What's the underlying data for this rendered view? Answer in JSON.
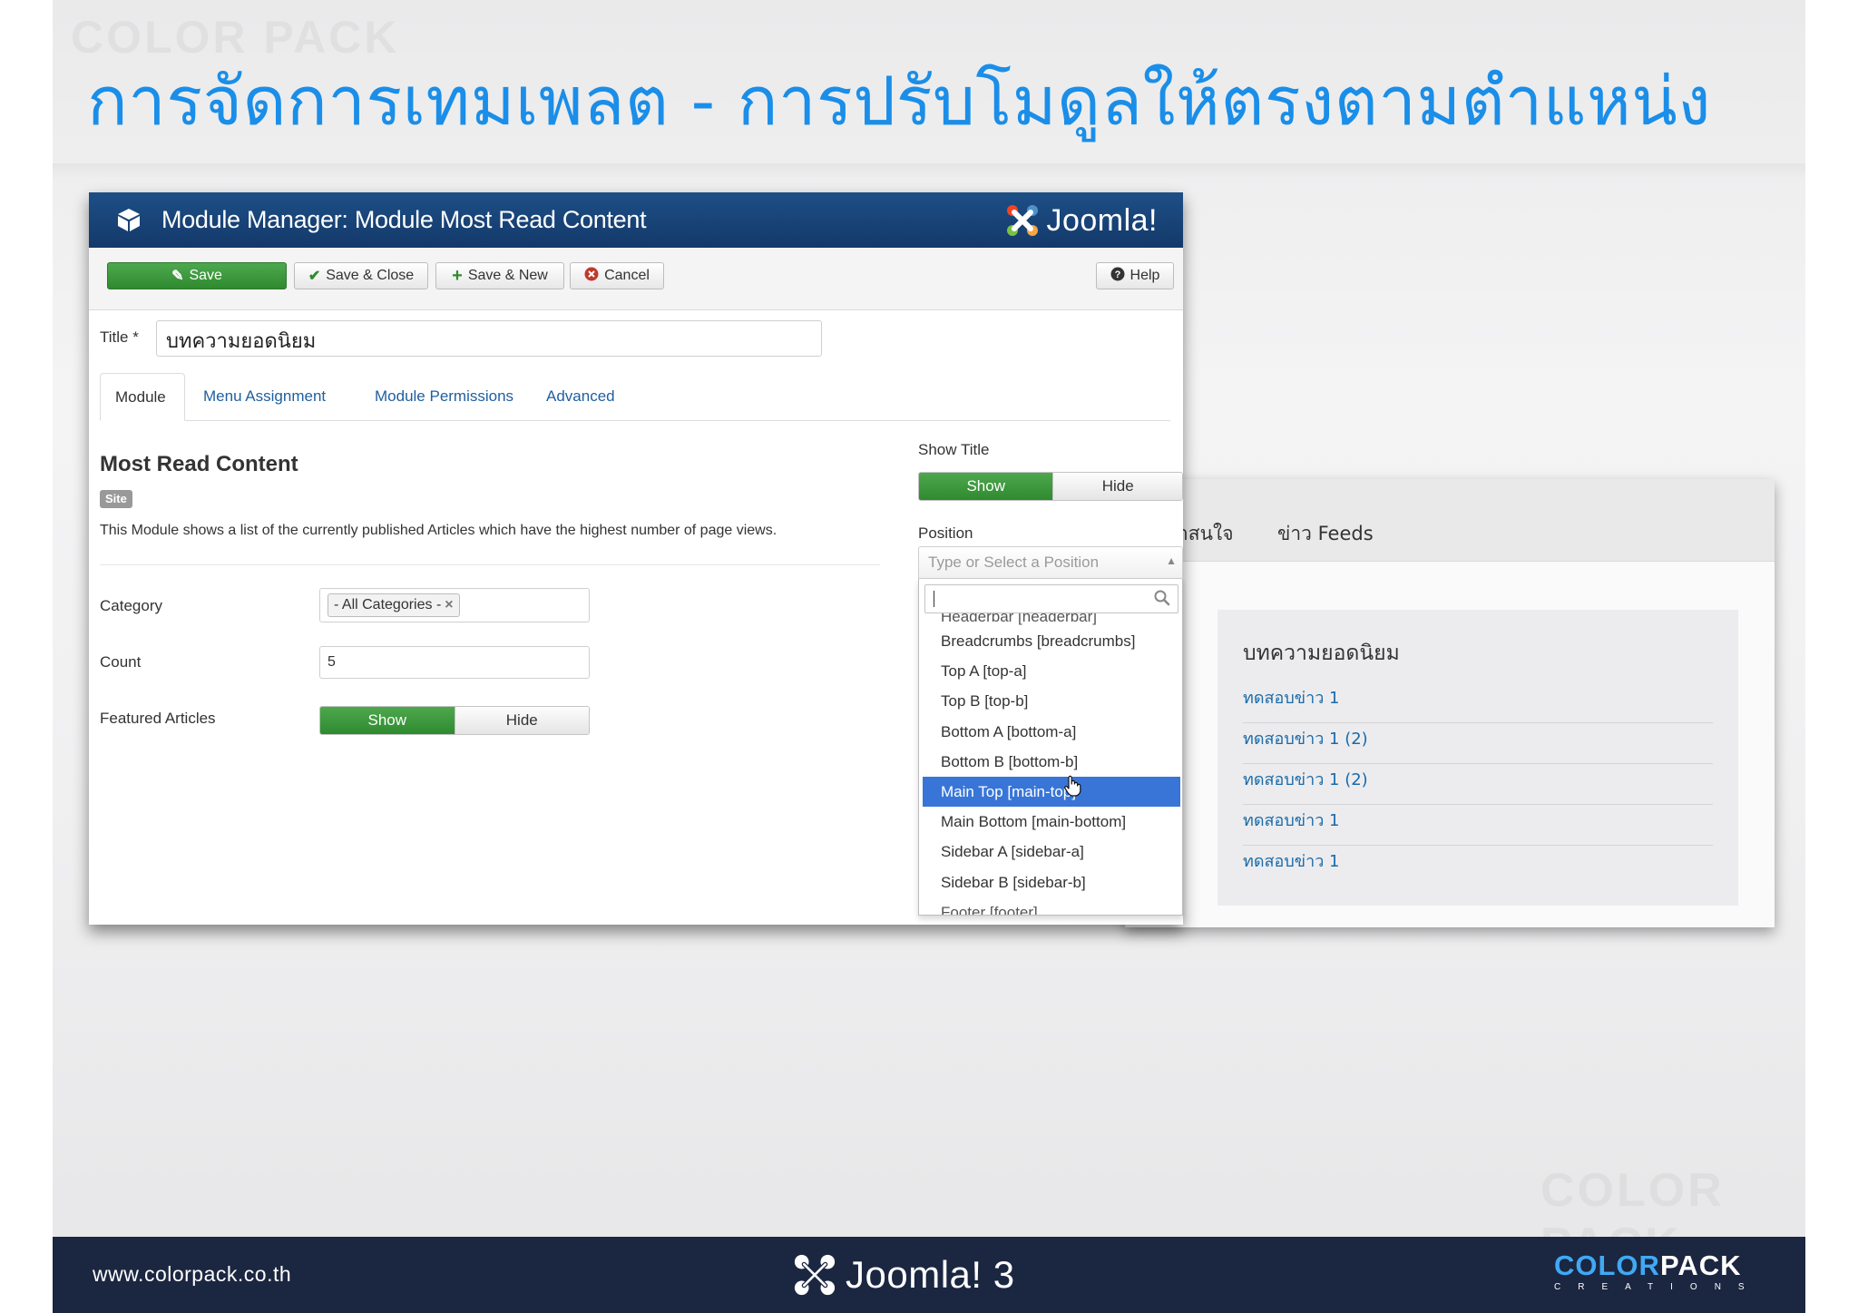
{
  "slide": {
    "title": "การจัดการเทมเพลต - การปรับโมดูลให้ตรงตามตำแหน่ง",
    "watermark_top": "COLOR PACK",
    "watermark_bottom": "COLOR PACK"
  },
  "admin": {
    "header_title": "Module Manager: Module Most Read Content",
    "brand": "Joomla!",
    "toolbar": {
      "save": "Save",
      "save_close": "Save & Close",
      "save_new": "Save & New",
      "cancel": "Cancel",
      "help": "Help"
    },
    "title_label": "Title *",
    "title_value": "บทความยอดนิยม",
    "tabs": [
      "Module",
      "Menu Assignment",
      "Module Permissions",
      "Advanced"
    ],
    "module_name": "Most Read Content",
    "badge": "Site",
    "description": "This Module shows a list of the currently published Articles which have the highest number of page views.",
    "fields": {
      "category_label": "Category",
      "category_value": "- All Categories -",
      "count_label": "Count",
      "count_value": "5",
      "featured_label": "Featured Articles",
      "featured_on": "Show",
      "featured_off": "Hide"
    },
    "show_title": {
      "label": "Show Title",
      "on": "Show",
      "off": "Hide"
    },
    "position": {
      "label": "Position",
      "placeholder": "Type or Select a Position",
      "options": [
        "Headerbar [headerbar]",
        "Breadcrumbs [breadcrumbs]",
        "Top A [top-a]",
        "Top B [top-b]",
        "Bottom A [bottom-a]",
        "Bottom B [bottom-b]",
        "Main Top [main-top]",
        "Main Bottom [main-bottom]",
        "Sidebar A [sidebar-a]",
        "Sidebar B [sidebar-b]",
        "Footer [footer]"
      ],
      "selected_index": 6
    }
  },
  "site": {
    "nav": [
      "่าสนใจ",
      "ข่าว Feeds"
    ],
    "module_title": "บทความยอดนิยม",
    "links": [
      "ทดสอบข่าว 1",
      "ทดสอบข่าว 1 (2)",
      "ทดสอบข่าว 1 (2)",
      "ทดสอบข่าว 1",
      "ทดสอบข่าว 1"
    ]
  },
  "footer": {
    "url": "www.colorpack.co.th",
    "joomla": "Joomla!",
    "joomla_version": "3",
    "brand_color": "COLOR",
    "brand_pack": "PACK",
    "brand_sub": "CREATIONS"
  },
  "colors": {
    "title_blue": "#1a8ee8",
    "admin_header": "#1d4f86",
    "save_green": "#3a9a3a",
    "dropdown_selected": "#3875d7",
    "link_blue": "#1a6aa8",
    "footer_bg": "#1b2641"
  }
}
